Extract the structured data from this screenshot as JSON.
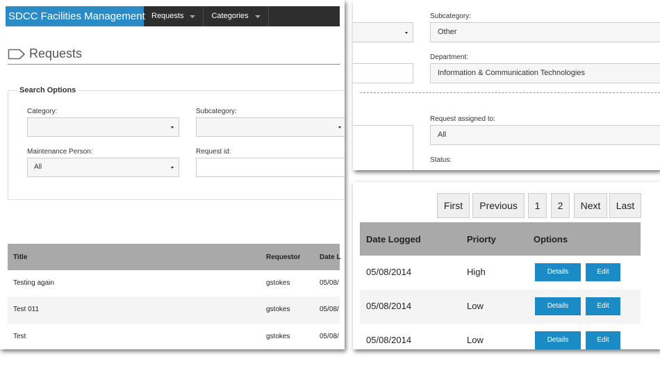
{
  "left_panel": {
    "topbar": {
      "brand": "SDCC Facilities Management",
      "nav": [
        {
          "label": "Requests"
        },
        {
          "label": "Categories"
        }
      ]
    },
    "page": {
      "icon": "tag-icon",
      "title": "Requests"
    },
    "search_options": {
      "legend": "Search Options",
      "category_label": "Category:",
      "category_value": "",
      "subcategory_label": "Subcategory:",
      "subcategory_value": "",
      "maintenance_label": "Maintenance Person:",
      "maintenance_value": "All",
      "request_id_label": "Request id:",
      "request_id_value": ""
    },
    "table": {
      "headers": [
        "Title",
        "Requestor",
        "Date L"
      ],
      "rows": [
        [
          "Testing again",
          "gstokes",
          "05/08/"
        ],
        [
          "Test 011",
          "gstokes",
          "05/08/"
        ],
        [
          "Test",
          "gstokes",
          "05/08/"
        ]
      ]
    }
  },
  "top_right_panel": {
    "subcategory_label": "Subcategory:",
    "subcategory_value": "Other",
    "department_label": "Department:",
    "department_value": "Information & Communication Technologies",
    "assigned_label": "Request assigned to:",
    "assigned_value": "All",
    "status_label": "Status:"
  },
  "bottom_right_panel": {
    "pagination": [
      "First",
      "Previous",
      "1",
      "2",
      "Next",
      "Last"
    ],
    "table": {
      "headers": [
        "Date Logged",
        "Priorty",
        "Options"
      ],
      "rows": [
        {
          "date": "05/08/2014",
          "priority": "High"
        },
        {
          "date": "05/08/2014",
          "priority": "Low"
        },
        {
          "date": "05/08/2014",
          "priority": "Low"
        }
      ],
      "details_label": "Details",
      "edit_label": "Edit"
    }
  },
  "colors": {
    "brand": "#2a8bc6",
    "topbar": "#2e2e2e",
    "table_header": "#a9a9a9",
    "button": "#1a8bc4"
  }
}
